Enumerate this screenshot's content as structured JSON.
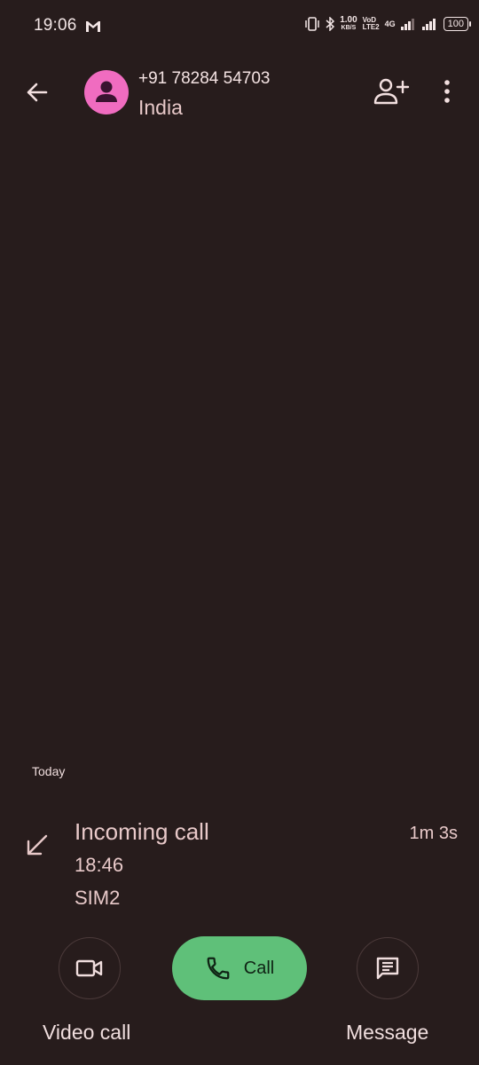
{
  "status_bar": {
    "time": "19:06",
    "speed_value": "1.00",
    "speed_unit": "KB/S",
    "volte_top": "VoD",
    "volte_bottom": "LTE2",
    "network": "4G",
    "battery": "100"
  },
  "header": {
    "contact_number": "+91 78284 54703",
    "contact_country": "India"
  },
  "history": {
    "section_date": "Today",
    "entries": [
      {
        "type": "Incoming call",
        "time": "18:46",
        "sim": "SIM2",
        "duration": "1m 3s"
      }
    ]
  },
  "actions": {
    "video_label": "Video call",
    "call_label": "Call",
    "message_label": "Message"
  },
  "colors": {
    "background": "#271c1c",
    "avatar": "#f06cc0",
    "call_button": "#5fc079",
    "text": "#e8c9c9"
  }
}
